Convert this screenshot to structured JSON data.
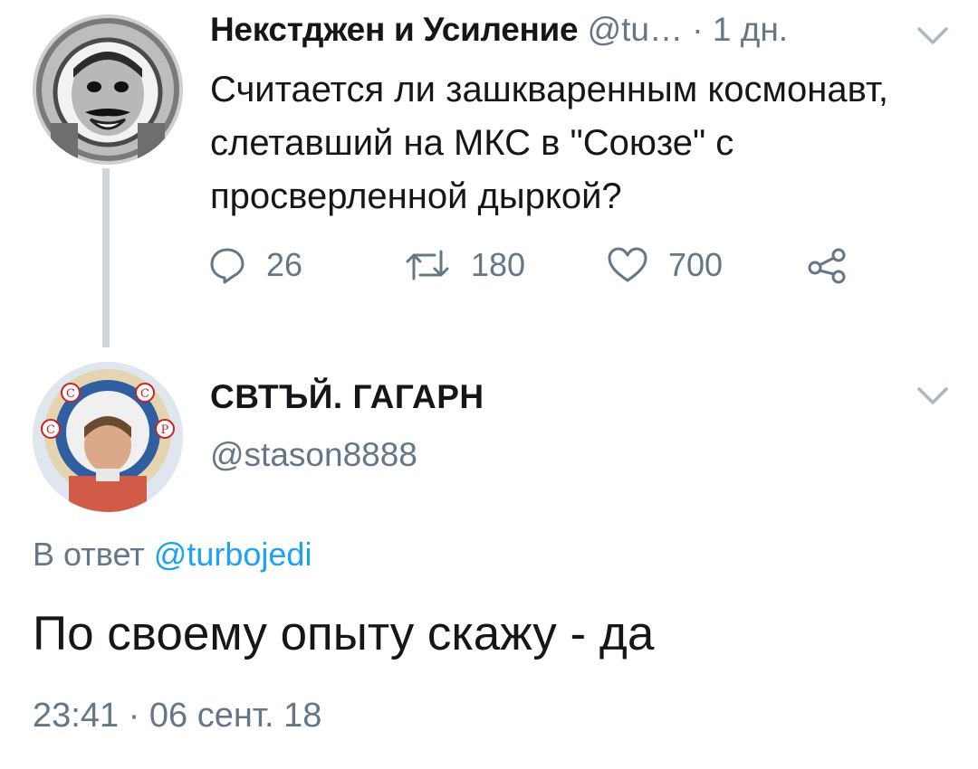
{
  "parent_tweet": {
    "author_name": "Некстджен и Усиление",
    "author_handle": "@tu…",
    "separator": "·",
    "time_ago": "1 дн.",
    "text": "Считается ли зашкваренным космонавт, слетавший на МКС в \"Союзе\" с просверленной дыркой?",
    "actions": {
      "reply_count": "26",
      "retweet_count": "180",
      "like_count": "700"
    },
    "avatar_icon": "astronaut-avatar",
    "menu_icon": "chevron-down-icon"
  },
  "reply_tweet": {
    "author_name": "СВТЪЙ.  ГАГАРН",
    "author_handle": "@stason8888",
    "in_reply_prefix": "В ответ",
    "in_reply_handle": "@turbojedi",
    "text": "По своему опыту скажу - да",
    "timestamp": "23:41 · 06 сент. 18",
    "avatar_icon": "gagarin-icon-avatar",
    "avatar_letters": [
      "С",
      "С",
      "С",
      "Р"
    ],
    "menu_icon": "chevron-down-icon"
  },
  "colors": {
    "text": "#14171a",
    "secondary": "#657786",
    "link": "#1da1f2",
    "thread_line": "#cfd6dc"
  }
}
